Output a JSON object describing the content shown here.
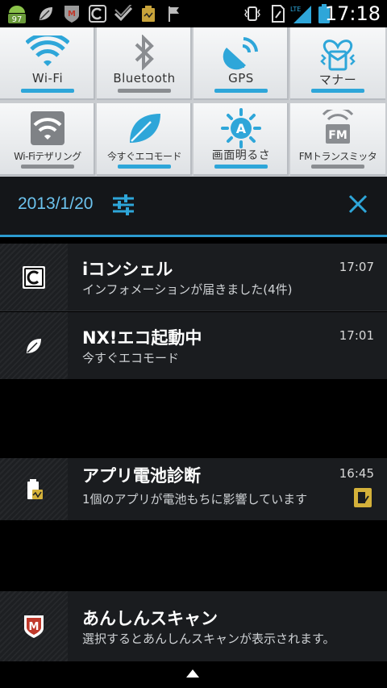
{
  "status_bar": {
    "badge_count": "97",
    "network_type": "LTE",
    "time": "17:18",
    "icons": [
      "android-icon",
      "leaf-icon",
      "mcafee-icon",
      "iconcier-icon",
      "check-icon",
      "battery-check-icon",
      "flag-icon",
      "vibrate-icon",
      "sim-icon",
      "signal-icon",
      "battery-icon"
    ]
  },
  "quick_settings": {
    "tiles": [
      {
        "label": "Wi-Fi",
        "icon": "wifi-icon",
        "on": true
      },
      {
        "label": "Bluetooth",
        "icon": "bluetooth-icon",
        "on": false
      },
      {
        "label": "GPS",
        "icon": "gps-icon",
        "on": true
      },
      {
        "label": "マナー",
        "icon": "manner-mode-icon",
        "on": true
      },
      {
        "label": "Wi-Fiテザリング",
        "icon": "wifi-tethering-icon",
        "on": false
      },
      {
        "label": "今すぐエコモード",
        "icon": "eco-leaf-icon",
        "on": true
      },
      {
        "label": "画面明るさ",
        "icon": "brightness-auto-icon",
        "on": true
      },
      {
        "label": "FMトランスミッタ",
        "icon": "fm-transmitter-icon",
        "on": false
      }
    ]
  },
  "header": {
    "date": "2013/1/20"
  },
  "notifications": [
    {
      "title": "iコンシェル",
      "subtitle": "インフォメーションが届きました(4件)",
      "time": "17:07"
    },
    {
      "title": "NX!エコ起動中",
      "subtitle": "今すぐエコモード",
      "time": "17:01"
    },
    {
      "title": "アプリ電池診断",
      "subtitle": "1個のアプリが電池もちに影響しています",
      "time": "16:45"
    },
    {
      "title": "あんしんスキャン",
      "subtitle": "選択するとあんしんスキャンが表示されます。",
      "time": ""
    }
  ],
  "colors": {
    "accent": "#2ea6d9",
    "date_text": "#6cc3ee",
    "panel_bg": "#1a1c1f"
  }
}
